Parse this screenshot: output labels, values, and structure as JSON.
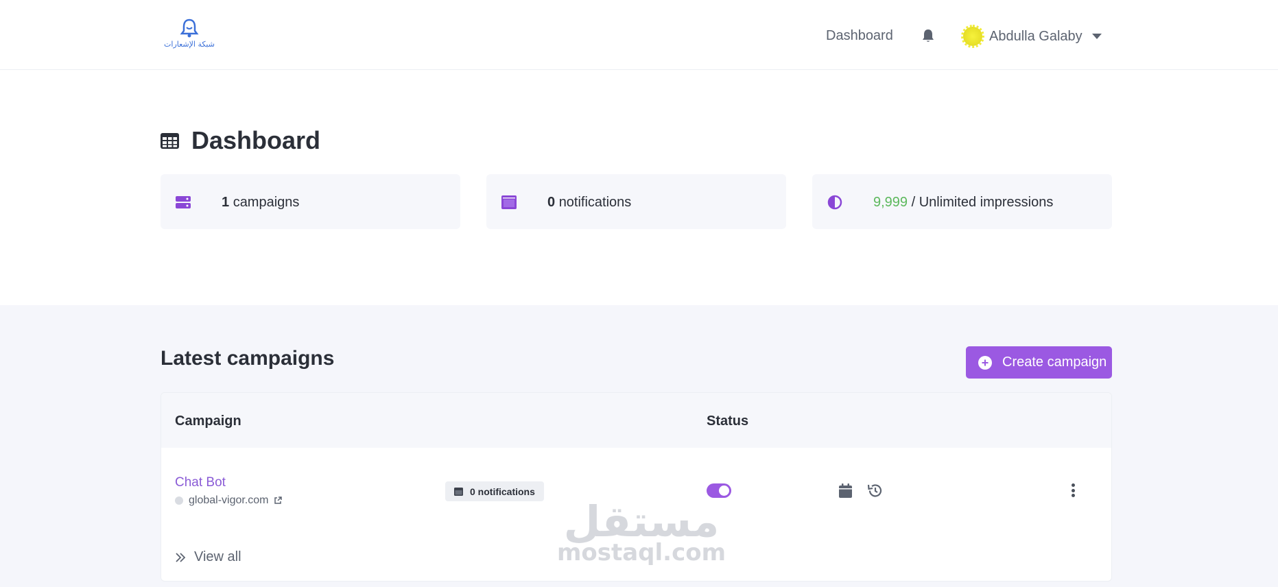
{
  "header": {
    "logo_text": "شبكة الإشعارات",
    "nav_dashboard": "Dashboard",
    "user_name": "Abdulla Galaby"
  },
  "page": {
    "title": "Dashboard"
  },
  "stats": {
    "campaigns": {
      "count": "1",
      "label": "campaigns"
    },
    "notifications": {
      "count": "0",
      "label": "notifications"
    },
    "impressions": {
      "used": "9,999",
      "label": "/ Unlimited impressions"
    }
  },
  "latest": {
    "title": "Latest campaigns",
    "create_label": "Create campaign",
    "columns": {
      "campaign": "Campaign",
      "status": "Status"
    },
    "rows": [
      {
        "name": "Chat Bot",
        "domain": "global-vigor.com",
        "notifications_badge": "0 notifications",
        "enabled": true
      }
    ],
    "view_all": "View all"
  },
  "watermark": {
    "arabic": "مستقل",
    "latin": "mostaql.com"
  },
  "colors": {
    "accent": "#9b59e2",
    "impressions_green": "#5cb85c",
    "text": "#2b2f38",
    "muted": "#5c6370"
  },
  "icons": {
    "logo": "bell-logo-icon",
    "bell": "bell-icon",
    "title": "table-icon",
    "campaigns": "server-icon",
    "notifications": "window-icon",
    "impressions": "adjust-icon",
    "create": "plus-circle-icon",
    "calendar": "calendar-icon",
    "history": "history-icon",
    "menu": "ellipsis-vertical-icon",
    "view_all": "double-chevron-right-icon"
  }
}
